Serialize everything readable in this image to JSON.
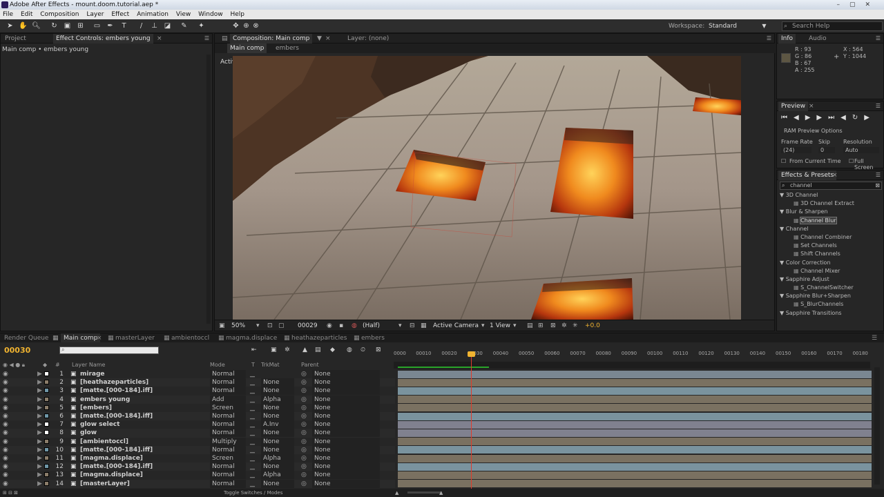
{
  "window": {
    "title": "Adobe After Effects - mount.doom.tutorial.aep *"
  },
  "menu": [
    "File",
    "Edit",
    "Composition",
    "Layer",
    "Effect",
    "Animation",
    "View",
    "Window",
    "Help"
  ],
  "toolbar": {
    "workspace_label": "Workspace:",
    "workspace_value": "Standard",
    "search_placeholder": "Search Help"
  },
  "left_panel": {
    "tabs": [
      "Project",
      "Effect Controls: embers young"
    ],
    "subtitle": "Main comp • embers young"
  },
  "composition_panel": {
    "tabs": [
      "Composition: Main comp",
      "Layer: (none)"
    ],
    "breadcrumbs": [
      "Main comp",
      "embers"
    ],
    "view_label": "Active Camera",
    "footer": {
      "zoom": "50%",
      "timecode": "00029",
      "resolution": "(Half)",
      "camera": "Active Camera",
      "views": "1 View",
      "exposure": "+0.0"
    }
  },
  "info_panel": {
    "tabs": [
      "Info",
      "Audio"
    ],
    "r": "R : 93",
    "g": "G : 86",
    "b": "B : 67",
    "a": "A : 255",
    "x": "X : 564",
    "y": "Y : 1044",
    "swatch_color": "#5d5643"
  },
  "preview_panel": {
    "tab": "Preview",
    "ram_options": "RAM Preview Options",
    "frame_rate_label": "Frame Rate",
    "skip_label": "Skip",
    "resolution_label": "Resolution",
    "frame_rate": "(24)",
    "skip": "0",
    "resolution": "Auto",
    "from_current": "From Current Time",
    "full_screen": "Full Screen"
  },
  "effects_panel": {
    "tab": "Effects & Presets",
    "search_value": "channel",
    "items": [
      {
        "label": "3D Channel",
        "kind": "category"
      },
      {
        "label": "3D Channel Extract",
        "kind": "effect"
      },
      {
        "label": "Blur & Sharpen",
        "kind": "category"
      },
      {
        "label": "Channel Blur",
        "kind": "effect",
        "selected": true
      },
      {
        "label": "Channel",
        "kind": "category"
      },
      {
        "label": "Channel Combiner",
        "kind": "effect"
      },
      {
        "label": "Set Channels",
        "kind": "effect"
      },
      {
        "label": "Shift Channels",
        "kind": "effect"
      },
      {
        "label": "Color Correction",
        "kind": "category"
      },
      {
        "label": "Channel Mixer",
        "kind": "effect"
      },
      {
        "label": "Sapphire Adjust",
        "kind": "category"
      },
      {
        "label": "S_ChannelSwitcher",
        "kind": "effect"
      },
      {
        "label": "Sapphire Blur+Sharpen",
        "kind": "category"
      },
      {
        "label": "S_BlurChannels",
        "kind": "effect"
      },
      {
        "label": "Sapphire Transitions",
        "kind": "category"
      }
    ]
  },
  "timeline_tabs": [
    "Render Queue",
    "Main comp",
    "masterLayer",
    "ambientoccl",
    "magma.displace",
    "heathazeparticles",
    "embers"
  ],
  "timeline": {
    "current_time": "00030",
    "col_headers": {
      "layer_name": "Layer Name",
      "mode": "Mode",
      "t": "T",
      "trkmat": "TrkMat",
      "parent": "Parent"
    },
    "ruler": [
      "0000",
      "00010",
      "00020",
      "00030",
      "00040",
      "00050",
      "00060",
      "00070",
      "00080",
      "00090",
      "00100",
      "00110",
      "00120",
      "00130",
      "00140",
      "00150",
      "00160",
      "00170",
      "00180"
    ],
    "layers": [
      {
        "num": "1",
        "name": "mirage",
        "mode": "Normal",
        "trkmat": "",
        "parent": "None",
        "color": "#ffffff",
        "bar": "#7a8792"
      },
      {
        "num": "2",
        "name": "[heathazeparticles]",
        "mode": "Normal",
        "trkmat": "None",
        "parent": "None",
        "color": "#8b7d6a",
        "bar": "#7a7161"
      },
      {
        "num": "3",
        "name": "[matte.[000-184].iff]",
        "mode": "Normal",
        "trkmat": "None",
        "parent": "None",
        "color": "#6f97a8",
        "bar": "#7a939e"
      },
      {
        "num": "4",
        "name": "embers young",
        "mode": "Add",
        "trkmat": "Alpha",
        "parent": "None",
        "color": "#8b7d6a",
        "bar": "#7a7161"
      },
      {
        "num": "5",
        "name": "[embers]",
        "mode": "Screen",
        "trkmat": "None",
        "parent": "None",
        "color": "#8b7d6a",
        "bar": "#7a7161"
      },
      {
        "num": "6",
        "name": "[matte.[000-184].iff]",
        "mode": "Normal",
        "trkmat": "None",
        "parent": "None",
        "color": "#6f97a8",
        "bar": "#7a939e"
      },
      {
        "num": "7",
        "name": "glow select",
        "mode": "Normal",
        "trkmat": "A.Inv",
        "parent": "None",
        "color": "#ffffff",
        "bar": "#80818f"
      },
      {
        "num": "8",
        "name": "glow",
        "mode": "Normal",
        "trkmat": "None",
        "parent": "None",
        "color": "#ffffff",
        "bar": "#80818f"
      },
      {
        "num": "9",
        "name": "[ambientoccl]",
        "mode": "Multiply",
        "trkmat": "None",
        "parent": "None",
        "color": "#8b7d6a",
        "bar": "#7a7161"
      },
      {
        "num": "10",
        "name": "[matte.[000-184].iff]",
        "mode": "Normal",
        "trkmat": "None",
        "parent": "None",
        "color": "#6f97a8",
        "bar": "#7a939e"
      },
      {
        "num": "11",
        "name": "[magma.displace]",
        "mode": "Screen",
        "trkmat": "Alpha",
        "parent": "None",
        "color": "#8b7d6a",
        "bar": "#7a7161"
      },
      {
        "num": "12",
        "name": "[matte.[000-184].iff]",
        "mode": "Normal",
        "trkmat": "None",
        "parent": "None",
        "color": "#6f97a8",
        "bar": "#7a939e"
      },
      {
        "num": "13",
        "name": "[magma.displace]",
        "mode": "Normal",
        "trkmat": "Alpha",
        "parent": "None",
        "color": "#8b7d6a",
        "bar": "#7a7161"
      },
      {
        "num": "14",
        "name": "[masterLayer]",
        "mode": "Normal",
        "trkmat": "None",
        "parent": "None",
        "color": "#8b7d6a",
        "bar": "#7a7161"
      }
    ],
    "footer_label": "Toggle Switches / Modes"
  }
}
